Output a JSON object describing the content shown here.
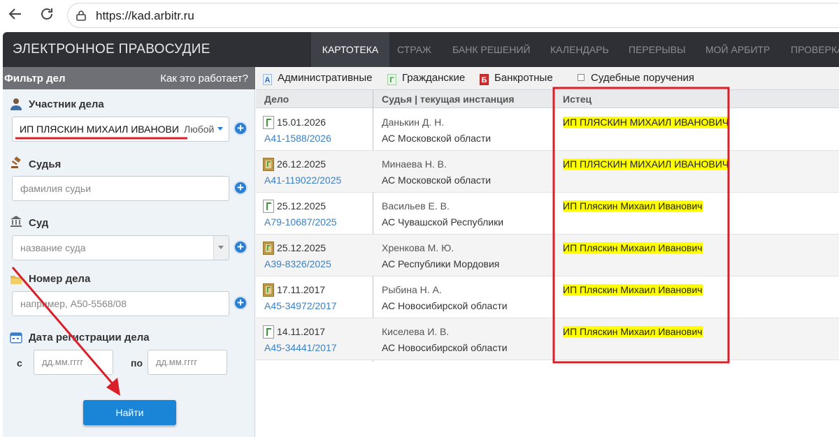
{
  "browser": {
    "url": "https://kad.arbitr.ru"
  },
  "header": {
    "brand": "ЭЛЕКТРОННОЕ ПРАВОСУДИЕ",
    "nav": [
      {
        "label": "КАРТОТЕКА",
        "active": true
      },
      {
        "label": "СТРАЖ"
      },
      {
        "label": "БАНК РЕШЕНИЙ"
      },
      {
        "label": "КАЛЕНДАРЬ"
      },
      {
        "label": "ПЕРЕРЫВЫ"
      },
      {
        "label": "МОЙ АРБИТР"
      },
      {
        "label": "ПРОВЕРКА"
      }
    ]
  },
  "filter": {
    "title": "Фильтр дел",
    "help": "Как это работает?",
    "participant": {
      "label": "Участник дела",
      "value": "ИП ПЛЯСКИН МИХАИЛ ИВАНОВИ",
      "role": "Любой"
    },
    "judge": {
      "label": "Судья",
      "placeholder": "фамилия судьи"
    },
    "court": {
      "label": "Суд",
      "placeholder": "название суда"
    },
    "casenum": {
      "label": "Номер дела",
      "placeholder": "например, А50-5568/08"
    },
    "date": {
      "label": "Дата регистрации дела",
      "from_label": "с",
      "to_label": "по",
      "from_placeholder": "дд.мм.гггг",
      "to_placeholder": "дд.мм.гггг"
    },
    "find_button": "Найти"
  },
  "tabs": [
    {
      "label": "Административные",
      "icon": "А",
      "color": "#2b6cc4"
    },
    {
      "label": "Гражданские",
      "icon": "Г",
      "color": "#3a9a3a"
    },
    {
      "label": "Банкротные",
      "icon": "Б",
      "color": "#d03030"
    },
    {
      "label": "Судебные поручения",
      "icon": "checkbox"
    }
  ],
  "table": {
    "headers": {
      "case": "Дело",
      "judge": "Судья | текущая инстанция",
      "plaintiff": "Истец"
    },
    "rows": [
      {
        "date": "15.01.2026",
        "number": "А41-1588/2026",
        "judge": "Данькин Д. Н.",
        "court": "АС Московской области",
        "plaintiff": "ИП ПЛЯСКИН МИХАИЛ ИВАНОВИЧ",
        "icon": "civil"
      },
      {
        "date": "26.12.2025",
        "number": "А41-119022/2025",
        "judge": "Минаева Н. В.",
        "court": "АС Московской области",
        "plaintiff": "ИП ПЛЯСКИН МИХАИЛ ИВАНОВИЧ",
        "icon": "archive"
      },
      {
        "date": "25.12.2025",
        "number": "А79-10687/2025",
        "judge": "Васильев Е. В.",
        "court": "АС Чувашской Республики",
        "plaintiff": "ИП Пляскин Михаил Иванович",
        "icon": "civil"
      },
      {
        "date": "25.12.2025",
        "number": "А39-8326/2025",
        "judge": "Хренкова М. Ю.",
        "court": "АС Республики Мордовия",
        "plaintiff": "ИП Пляскин Михаил Иванович",
        "icon": "archive"
      },
      {
        "date": "17.11.2017",
        "number": "А45-34972/2017",
        "judge": "Рыбина Н. А.",
        "court": "АС Новосибирской области",
        "plaintiff": "ИП Пляскин Михаил Иванович",
        "icon": "archive"
      },
      {
        "date": "14.11.2017",
        "number": "А45-34441/2017",
        "judge": "Киселева И. В.",
        "court": "АС Новосибирской области",
        "plaintiff": "ИП Пляскин Михаил Иванович",
        "icon": "civil"
      }
    ]
  },
  "annotation_color": "#d9202a"
}
